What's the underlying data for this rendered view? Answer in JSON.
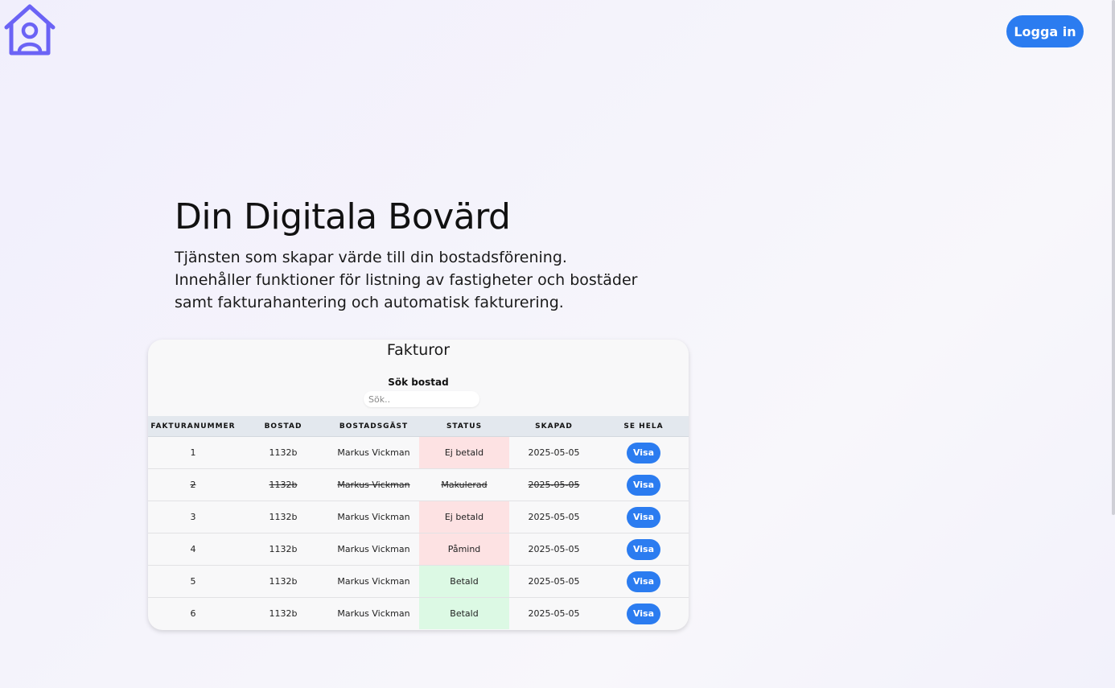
{
  "header": {
    "logo_icon": "house-user-icon",
    "login_label": "Logga in"
  },
  "hero": {
    "title": "Din Digitala Bovärd",
    "text": "Tjänsten som skapar värde till din bostadsförening. Innehåller funktioner för listning av fastigheter och bostäder samt fakturahantering och automatisk fakturering."
  },
  "invoices": {
    "title": "Fakturor",
    "search_label": "Sök bostad",
    "search_placeholder": "Sök..",
    "search_value": "",
    "columns": [
      "Fakturanummer",
      "Bostad",
      "Bostadsgäst",
      "Status",
      "Skapad",
      "Se hela"
    ],
    "rows": [
      {
        "number": "1",
        "unit": "1132b",
        "guest": "Markus Vickman",
        "status": "Ej betald",
        "created": "2025-05-05",
        "action": "Visa"
      },
      {
        "number": "2",
        "unit": "1132b",
        "guest": "Markus Vickman",
        "status": "Makulerad",
        "created": "2025-05-05",
        "action": "Visa"
      },
      {
        "number": "3",
        "unit": "1132b",
        "guest": "Markus Vickman",
        "status": "Ej betald",
        "created": "2025-05-05",
        "action": "Visa"
      },
      {
        "number": "4",
        "unit": "1132b",
        "guest": "Markus Vickman",
        "status": "Påmind",
        "created": "2025-05-05",
        "action": "Visa"
      },
      {
        "number": "5",
        "unit": "1132b",
        "guest": "Markus Vickman",
        "status": "Betald",
        "created": "2025-05-05",
        "action": "Visa"
      },
      {
        "number": "6",
        "unit": "1132b",
        "guest": "Markus Vickman",
        "status": "Betald",
        "created": "2025-05-05",
        "action": "Visa"
      }
    ]
  },
  "colors": {
    "accent": "#2b7cf0",
    "logo": "#6b63f5",
    "unpaid_bg": "#fde2e3",
    "paid_bg": "#dcf9e4",
    "header_bg": "#e3e8ee"
  }
}
